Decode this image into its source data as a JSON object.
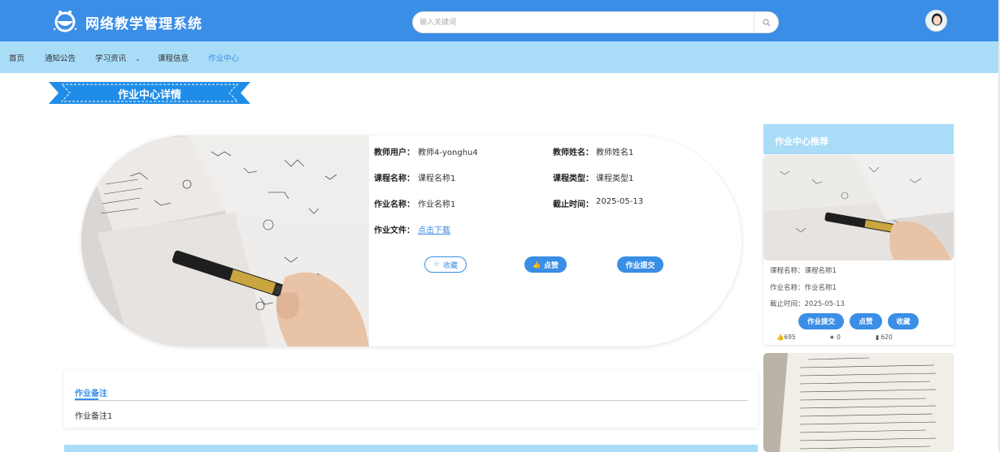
{
  "header": {
    "title": "网络教学管理系统",
    "search_placeholder": "输入关键词"
  },
  "nav": {
    "items": [
      "首页",
      "通知公告",
      "学习资讯",
      "课程信息",
      "作业中心"
    ],
    "active": "作业中心"
  },
  "page_title": "作业中心详情",
  "detail": {
    "teacher_user_label": "教师用户：",
    "teacher_user_value": "教师4-yonghu4",
    "teacher_name_label": "教师姓名：",
    "teacher_name_value": "教师姓名1",
    "course_name_label": "课程名称：",
    "course_name_value": "课程名称1",
    "course_type_label": "课程类型：",
    "course_type_value": "课程类型1",
    "homework_name_label": "作业名称：",
    "homework_name_value": "作业名称1",
    "deadline_label": "截止时间：",
    "deadline_value": "2025-05-13",
    "file_label": "作业文件：",
    "file_link": "点击下载",
    "collect_label": "收藏",
    "like_label": "点赞",
    "submit_label": "作业提交"
  },
  "notes": {
    "title": "作业备注",
    "content": "作业备注1"
  },
  "recommend": {
    "title": "作业中心推荐",
    "course_line": "课程名称：课程名称1",
    "homework_line": "作业名称：作业名称1",
    "deadline_line": "截止时间：2025-05-13",
    "submit_label": "作业提交",
    "like_label": "点赞",
    "collect_label": "收藏",
    "likes": "695",
    "stars": "0",
    "views": "620"
  },
  "colors": {
    "primary": "#3a8ee6",
    "nav_bg": "#a9dcf7"
  }
}
